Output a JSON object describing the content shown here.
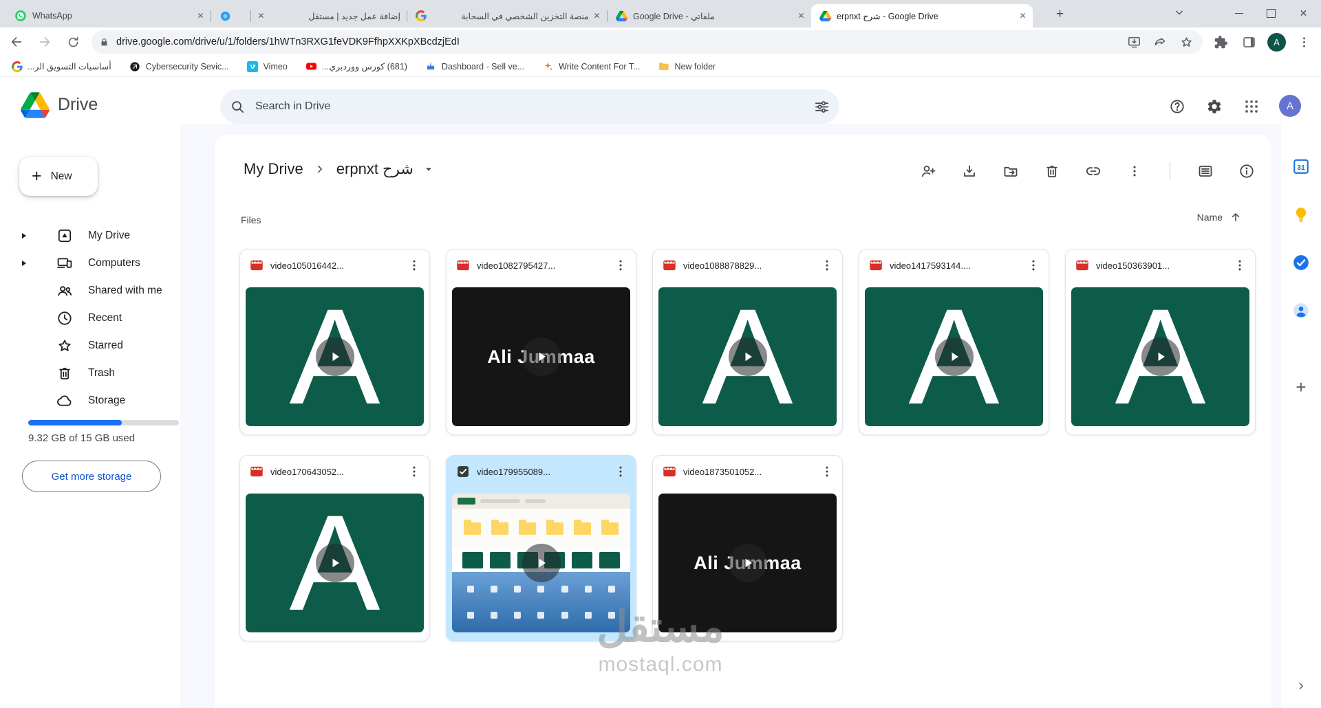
{
  "browser": {
    "tabs": [
      {
        "title": "WhatsApp",
        "icon": "whatsapp",
        "close": "right",
        "active": false
      },
      {
        "title": "",
        "icon": "bluedot",
        "close": "none",
        "active": false
      },
      {
        "title": "إضافة عمل جديد | مستقل",
        "icon": "none",
        "close": "left",
        "active": false
      },
      {
        "title": "منصة التخزين الشخصي في السحابة",
        "icon": "googleg",
        "close": "right",
        "active": false
      },
      {
        "title": "Google Drive - ملفاتي",
        "icon": "drivefav",
        "close": "right",
        "active": false
      },
      {
        "title": "erpnxt شرح - Google Drive",
        "icon": "drivefav",
        "close": "right",
        "active": true
      }
    ],
    "new_tab_label": "+",
    "close_glyph": "✕",
    "address": {
      "url": "drive.google.com/drive/u/1/folders/1hWTn3RXG1feVDK9FfhpXXKpXBcdzjEdI"
    },
    "profile_letter": "A",
    "bookmarks": [
      {
        "label": "أساسيات التسويق الر...",
        "icon": "googleg"
      },
      {
        "label": "Cybersecurity Sevic...",
        "icon": "darklogo"
      },
      {
        "label": "Vimeo",
        "icon": "vimeo"
      },
      {
        "label": "(681) كورس ووردبري...",
        "icon": "youtube"
      },
      {
        "label": "Dashboard - Sell ve...",
        "icon": "crown"
      },
      {
        "label": "Write Content For T...",
        "icon": "spark"
      },
      {
        "label": "New folder",
        "icon": "folderfav"
      }
    ]
  },
  "drive": {
    "brand": "Drive",
    "search_placeholder": "Search in Drive",
    "new_button": "New",
    "nav": [
      {
        "label": "My Drive",
        "icon": "mydrive",
        "expandable": true
      },
      {
        "label": "Computers",
        "icon": "computers",
        "expandable": true
      },
      {
        "label": "Shared with me",
        "icon": "shared",
        "expandable": false
      },
      {
        "label": "Recent",
        "icon": "recent",
        "expandable": false
      },
      {
        "label": "Starred",
        "icon": "starnav",
        "expandable": false
      },
      {
        "label": "Trash",
        "icon": "trashnav",
        "expandable": false
      },
      {
        "label": "Storage",
        "icon": "cloud",
        "expandable": false
      }
    ],
    "storage": {
      "percent": 62,
      "label": "9.32 GB of 15 GB used",
      "cta": "Get more storage"
    },
    "breadcrumb": {
      "root": "My Drive",
      "current": "erpnxt شرح"
    },
    "section_label": "Files",
    "sort_label": "Name",
    "profile_letter": "A",
    "files": [
      {
        "name": "video105016442...",
        "thumb": "green",
        "letter": "A"
      },
      {
        "name": "video1082795427...",
        "thumb": "dark",
        "overlay": "Ali Jummaa"
      },
      {
        "name": "video1088878829...",
        "thumb": "green",
        "letter": "A"
      },
      {
        "name": "video1417593144....",
        "thumb": "green",
        "letter": "A"
      },
      {
        "name": "video150363901...",
        "thumb": "green",
        "letter": "A"
      },
      {
        "name": "video170643052...",
        "thumb": "green",
        "letter": "A"
      },
      {
        "name": "video179955089...",
        "thumb": "desktop",
        "selected": true
      },
      {
        "name": "video1873501052...",
        "thumb": "dark",
        "overlay": "Ali Jummaa"
      }
    ]
  },
  "watermark": {
    "title": "مستقل",
    "domain": "mostaql.com"
  },
  "colors": {
    "thumb_green": "#0d5c49",
    "thumb_dark": "#151515",
    "selected_blue": "#c2e7ff",
    "accent_blue": "#1a73e8",
    "video_icon_red": "#d93025"
  }
}
